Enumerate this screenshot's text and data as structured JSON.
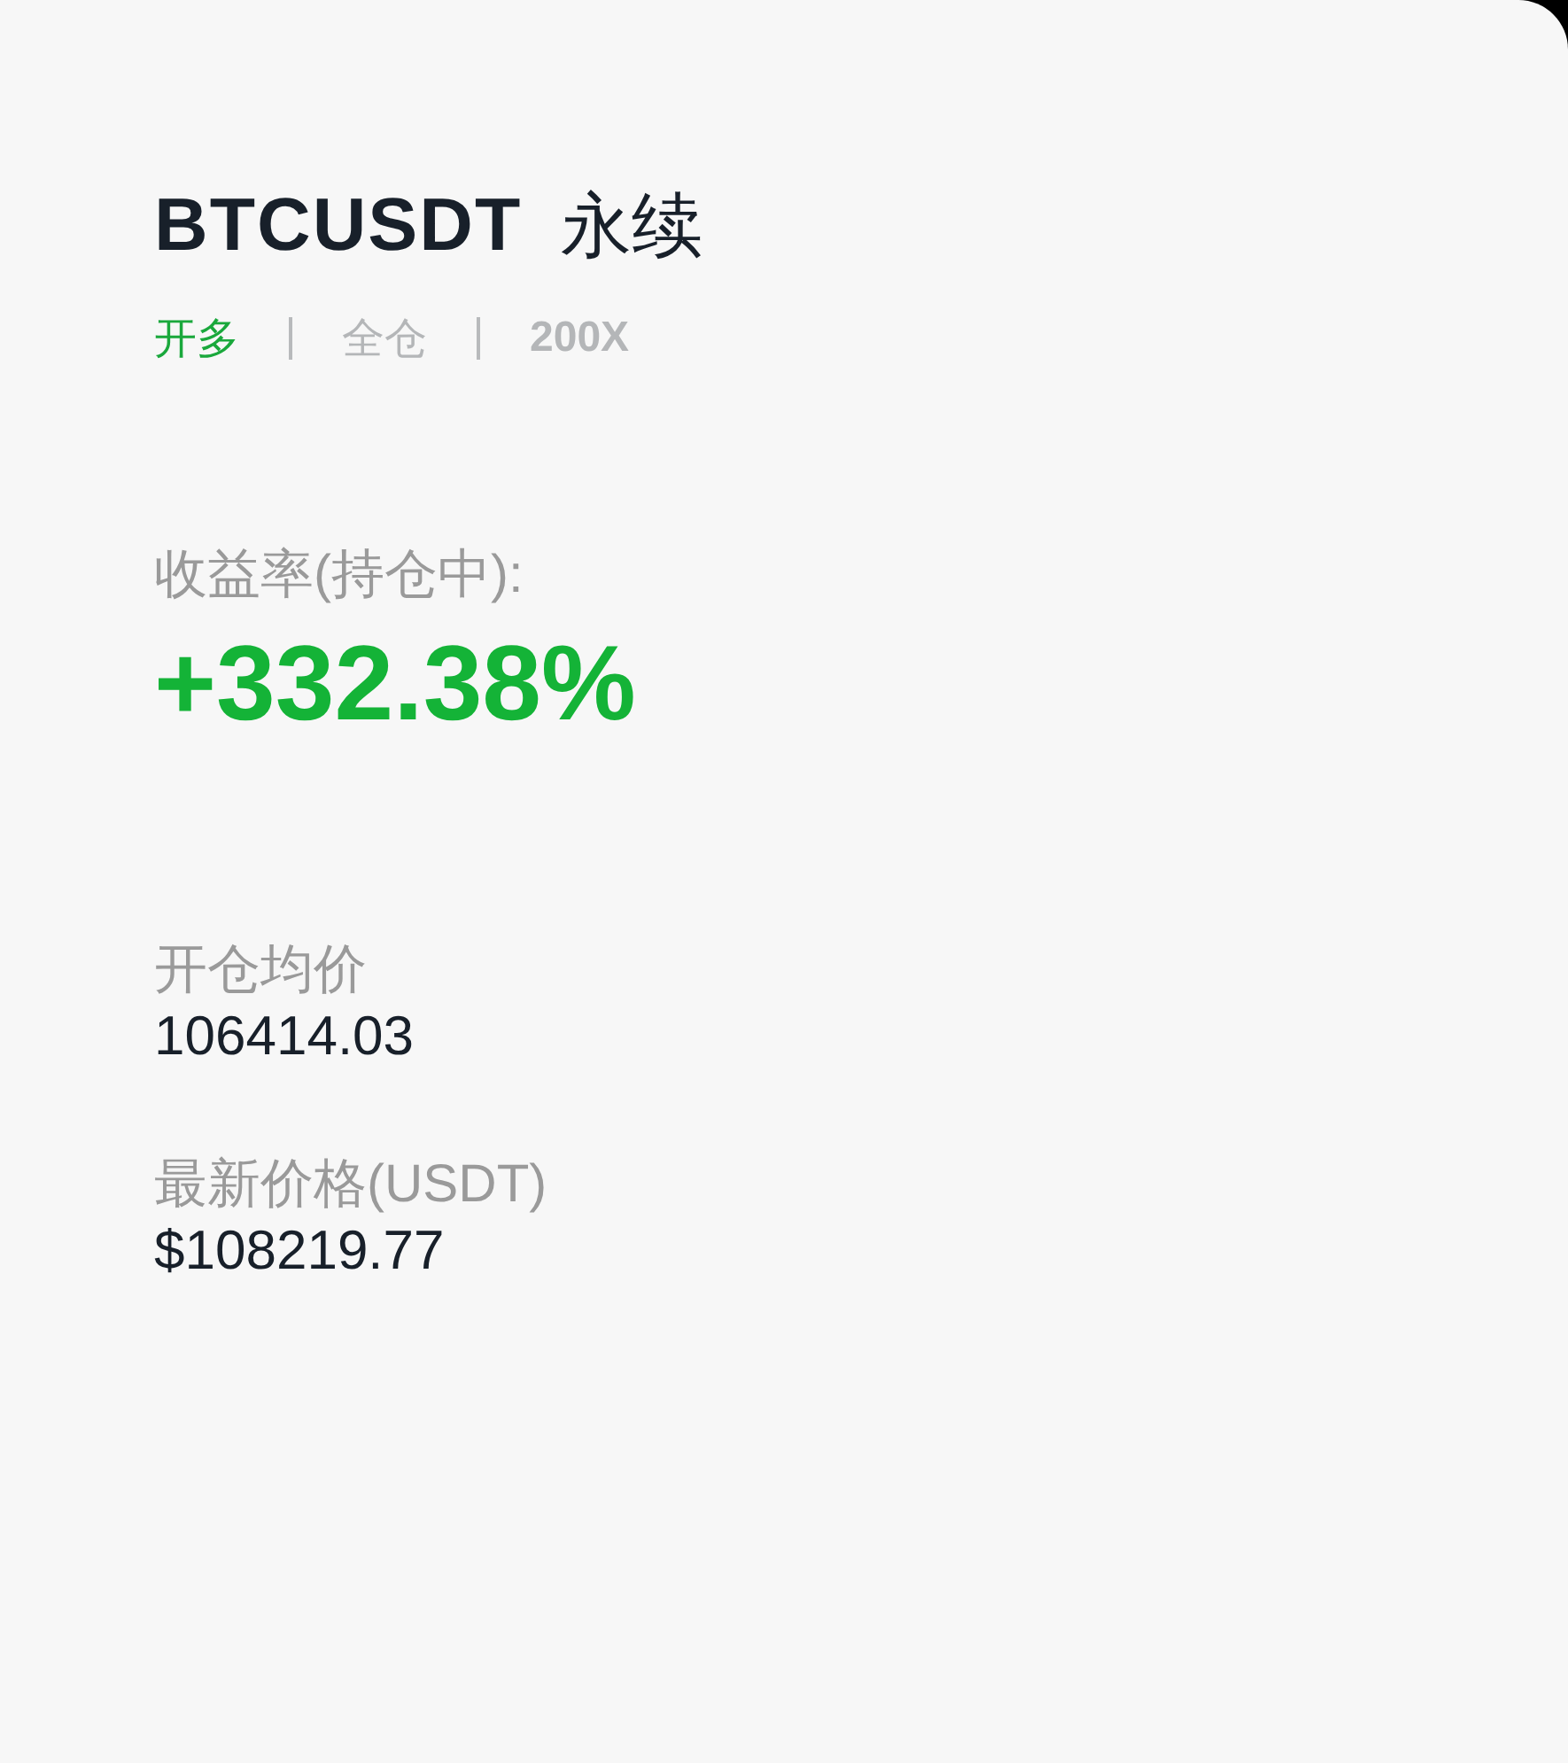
{
  "title": {
    "symbol": "BTCUSDT",
    "contract": "永续"
  },
  "tags": [
    {
      "label": "开多",
      "color": "#1aa83c"
    },
    {
      "label": "全仓",
      "color": "#b4b6b8"
    },
    {
      "label": "200X",
      "color": "#b4b6b8"
    }
  ],
  "return": {
    "label": "收益率(持仓中):",
    "value": "+332.38%"
  },
  "stats": [
    {
      "label": "开仓均价",
      "value": "106414.03"
    },
    {
      "label": "最新价格(USDT)",
      "value": "$108219.77"
    }
  ]
}
